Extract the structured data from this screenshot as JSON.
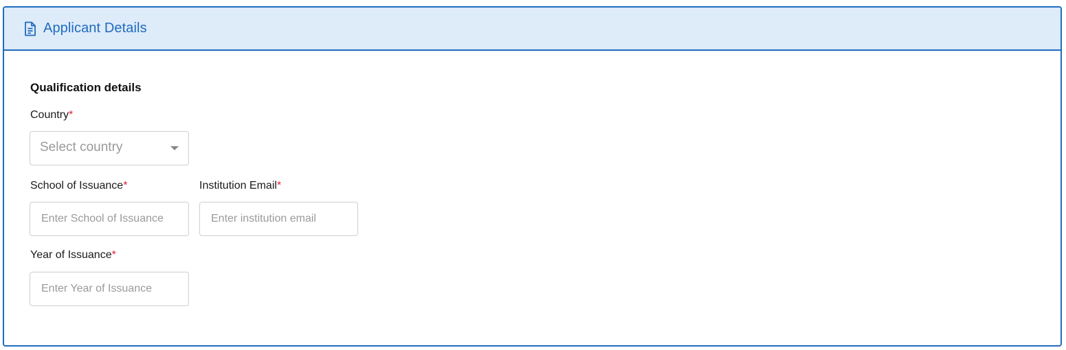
{
  "panel": {
    "title": "Applicant Details",
    "icon": "document-icon",
    "accent_color": "#1f6bbf",
    "header_bg": "#deebf8"
  },
  "form": {
    "section_title": "Qualification details",
    "required_marker": "*",
    "country": {
      "label": "Country",
      "placeholder": "Select country"
    },
    "school": {
      "label": "School of Issuance",
      "placeholder": "Enter School of Issuance"
    },
    "email": {
      "label": "Institution Email",
      "placeholder": "Enter institution email"
    },
    "year": {
      "label": "Year of Issuance",
      "placeholder": "Enter Year of Issuance"
    }
  }
}
